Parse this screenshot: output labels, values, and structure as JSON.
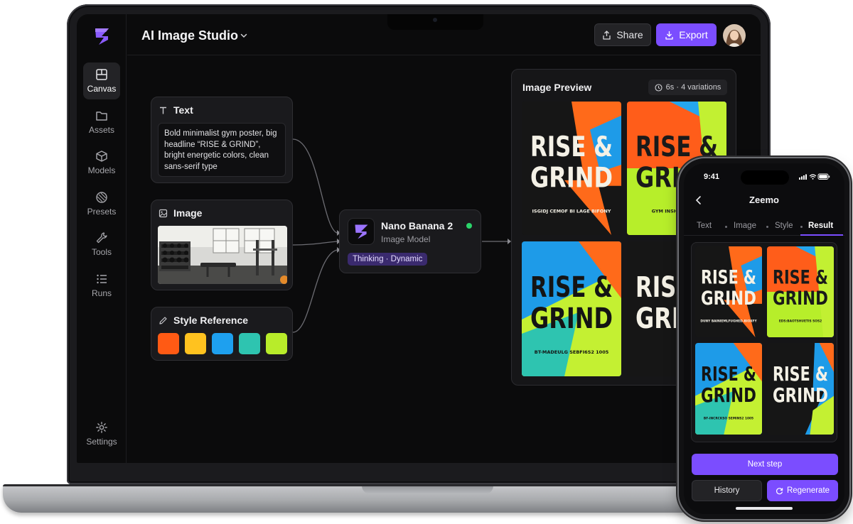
{
  "app": {
    "title": "AI Image Studio",
    "accent": "#7b4dff"
  },
  "sidebar": {
    "items": [
      {
        "label": "Canvas",
        "icon": "canvas-icon",
        "active": true
      },
      {
        "label": "Assets",
        "icon": "folder-icon"
      },
      {
        "label": "Models",
        "icon": "cube-icon"
      },
      {
        "label": "Presets",
        "icon": "presets-icon"
      },
      {
        "label": "Tools",
        "icon": "wrench-icon"
      },
      {
        "label": "Runs",
        "icon": "list-icon"
      }
    ],
    "settings_label": "Settings"
  },
  "toolbar": {
    "share_label": "Share",
    "export_label": "Export"
  },
  "nodes": {
    "text": {
      "label": "Text",
      "prompt": "Bold minimalist gym poster, big headline “RISE & GRIND”, bright energetic colors, clean sans-serif type"
    },
    "image": {
      "label": "Image"
    },
    "style": {
      "label": "Style Reference",
      "swatches": [
        "#ff5a14",
        "#ffc21f",
        "#1ea0ef",
        "#2ec4b0",
        "#b8ec2a"
      ]
    },
    "model": {
      "name": "Nano Banana 2",
      "subtitle": "Image Model",
      "tag": "Thinking · Dynamic",
      "status_color": "#2bd46a"
    }
  },
  "preview": {
    "title": "Image Preview",
    "meta": "6s · 4 variations",
    "posters": [
      {
        "headline1": "RISE &",
        "headline2": "GRIND",
        "caption": "ISGIDJ CEMOF BI LAGE BIFONY"
      },
      {
        "headline1": "RISE &",
        "headline2": "GRIND",
        "caption": "GYM INSHE BIFONY"
      },
      {
        "headline1": "RISE &",
        "headline2": "GRIND",
        "caption": "BT-MADEULG SEBFI6S2 1005"
      },
      {
        "headline1": "RISE &",
        "headline2": "GRIND",
        "caption": ""
      }
    ]
  },
  "phone": {
    "time": "9:41",
    "title": "Zeemo",
    "tabs": [
      {
        "label": "Text"
      },
      {
        "label": "Image"
      },
      {
        "label": "Style"
      },
      {
        "label": "Result",
        "active": true
      }
    ],
    "posters": [
      {
        "headline1": "RISE &",
        "headline2": "GRIND",
        "caption": "DUNY BAINIEMLFUGHED-BIOXFY"
      },
      {
        "headline1": "RISE &",
        "headline2": "GRIND",
        "caption": "EDS:BAOTSHUETIS SOS2"
      },
      {
        "headline1": "RISE &",
        "headline2": "GRIND",
        "caption": "BF-INCRCKSO SEMINS2 1005"
      },
      {
        "headline1": "RISE &",
        "headline2": "GRIND",
        "caption": ""
      }
    ],
    "next_label": "Next step",
    "history_label": "History",
    "regenerate_label": "Regenerate"
  }
}
